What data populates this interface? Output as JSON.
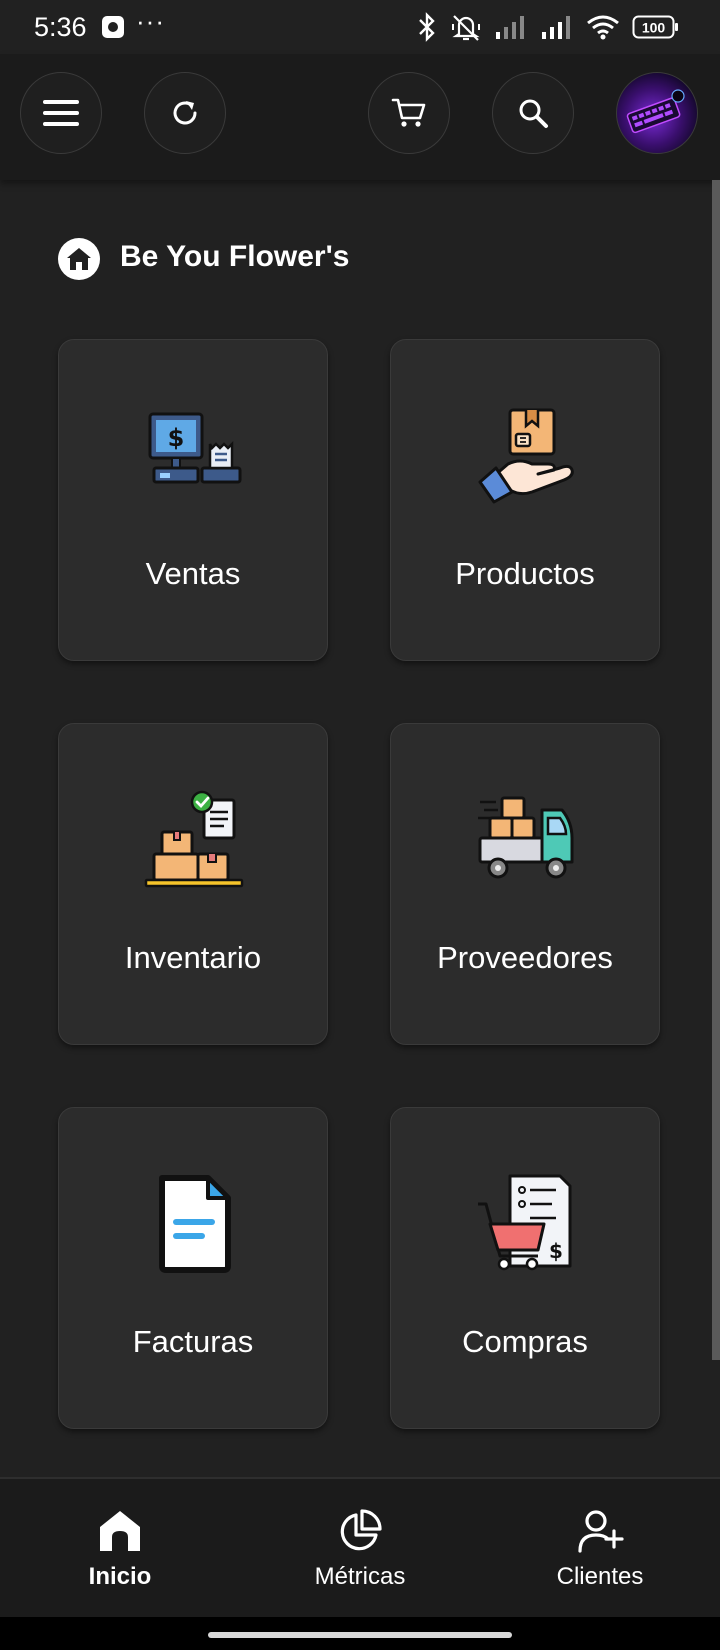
{
  "status_bar": {
    "time": "5:36",
    "overflow": "···",
    "battery": "100"
  },
  "app_bar": {
    "menu_icon": "menu-icon",
    "refresh_icon": "refresh-icon",
    "cart_icon": "cart-icon",
    "search_icon": "search-icon",
    "avatar": "user-avatar"
  },
  "header": {
    "title": "Be You Flower's"
  },
  "modules": [
    {
      "label": "Ventas",
      "icon": "cash-register-icon"
    },
    {
      "label": "Productos",
      "icon": "product-hand-box-icon"
    },
    {
      "label": "Inventario",
      "icon": "inventory-boxes-icon"
    },
    {
      "label": "Proveedores",
      "icon": "delivery-truck-icon"
    },
    {
      "label": "Facturas",
      "icon": "invoice-document-icon"
    },
    {
      "label": "Compras",
      "icon": "shopping-cart-receipt-icon"
    }
  ],
  "bottom_nav": [
    {
      "label": "Inicio",
      "icon": "home-icon",
      "active": true
    },
    {
      "label": "Métricas",
      "icon": "pie-chart-icon",
      "active": false
    },
    {
      "label": "Clientes",
      "icon": "add-user-icon",
      "active": false
    }
  ],
  "colors": {
    "background": "#212121",
    "card": "#2c2c2c",
    "bar": "#1b1b1b"
  }
}
